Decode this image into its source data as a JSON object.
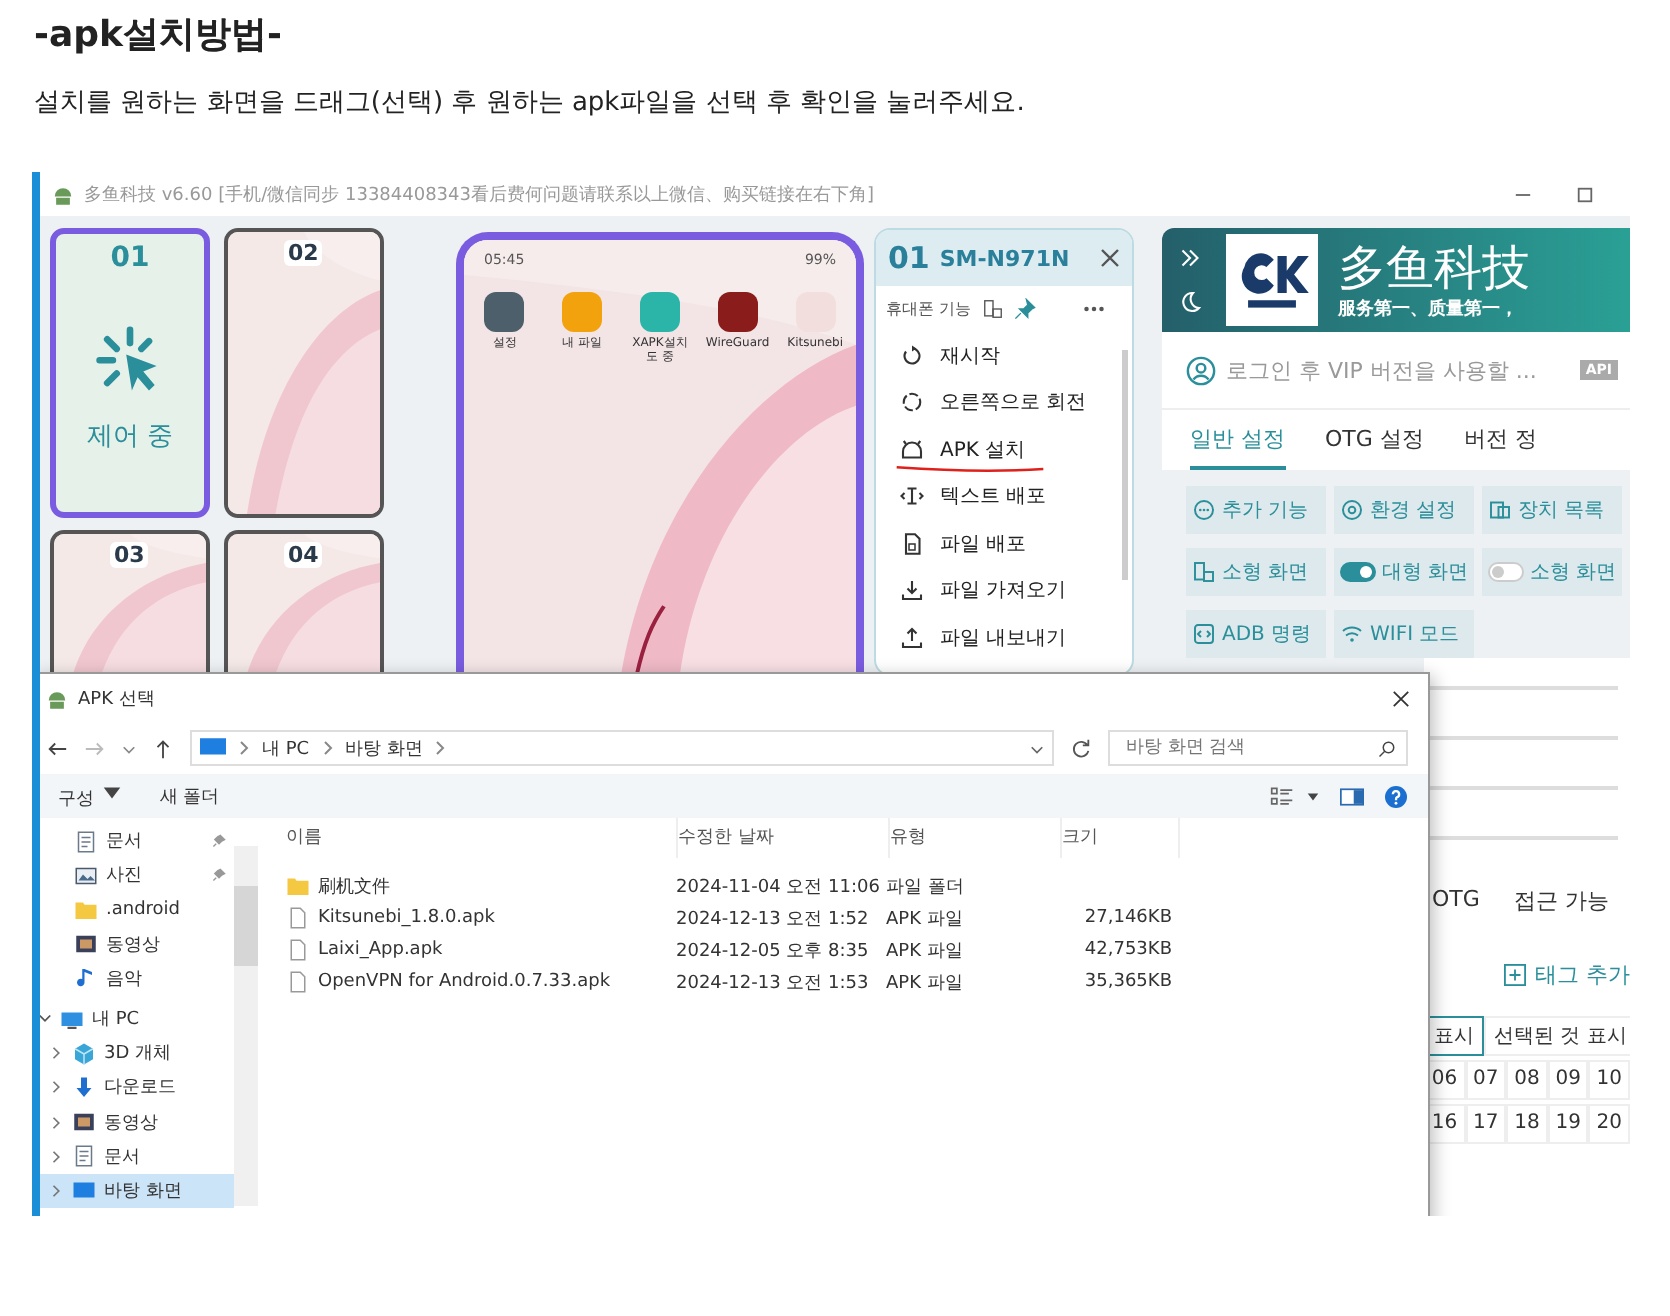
{
  "heading": "-apk설치방법-",
  "instruction": "설치를 원하는 화면을 드래그(선택) 후 원하는 apk파일을 선택 후 확인을 눌러주세요.",
  "app": {
    "title": "多鱼科技 v6.60 [手机/微信同步 13384408343看后费何问题请联系以上微信、购买链接在右下角]",
    "devices": [
      {
        "number": "01",
        "status": "제어 중",
        "selected": true
      },
      {
        "number": "02",
        "selected": false
      },
      {
        "number": "03",
        "selected": false
      },
      {
        "number": "04",
        "selected": false
      }
    ],
    "phone": {
      "time": "05:45",
      "battery": "99%",
      "apps": [
        {
          "label": "설정",
          "color": "#4d5f6b"
        },
        {
          "label": "내 파일",
          "color": "#f2a20c"
        },
        {
          "label": "XAPK설치도 중",
          "color": "#2bb5a8"
        },
        {
          "label": "WireGuard",
          "color": "#8a1c1c"
        },
        {
          "label": "Kitsunebi",
          "color": "#f3dede"
        }
      ]
    },
    "device_panel": {
      "number": "01",
      "model": "SM-N971N",
      "section": "휴대폰 기능",
      "items": [
        {
          "kind": "restart",
          "label": "재시작",
          "marked": false
        },
        {
          "kind": "rotate",
          "label": "오른쪽으로 회전",
          "marked": false
        },
        {
          "kind": "android",
          "label": "APK 설치",
          "marked": true
        },
        {
          "kind": "text",
          "label": "텍스트 배포",
          "marked": false
        },
        {
          "kind": "file",
          "label": "파일 배포",
          "marked": false
        },
        {
          "kind": "import",
          "label": "파일 가져오기",
          "marked": false
        },
        {
          "kind": "export",
          "label": "파일 내보내기",
          "marked": false
        }
      ]
    },
    "side_panel": {
      "brand": "多鱼科技",
      "slogan": "服务第一、质量第一，",
      "login": "로그인 후 VIP 버전을 사용할 ...",
      "api": "API",
      "tabs": [
        {
          "label": "일반 설정",
          "selected": true
        },
        {
          "label": "OTG 설정",
          "selected": false
        },
        {
          "label": "버전 정",
          "selected": false
        }
      ],
      "buttons": [
        {
          "kind": "more",
          "label": "추가 기능"
        },
        {
          "kind": "settings",
          "label": "환경 설정"
        },
        {
          "kind": "devices",
          "label": "장치 목록"
        },
        {
          "kind": "screen",
          "label": "소형 화면"
        },
        {
          "kind": "toggle",
          "label": "대형 화면",
          "on": true
        },
        {
          "kind": "toggle",
          "label": "소형 화면",
          "on": false
        },
        {
          "kind": "adb",
          "label": "ADB 명령"
        },
        {
          "kind": "wifi",
          "label": "WIFI 모드"
        }
      ],
      "filters": [
        "OTG",
        "접근 가능"
      ],
      "add_tag": "태그 추가",
      "show_buttons": [
        {
          "label": "표시",
          "selected": true
        },
        {
          "label": "선택된 것 표시",
          "selected": false
        }
      ],
      "numbers": [
        [
          "06",
          "07",
          "08",
          "09",
          "10"
        ],
        [
          "16",
          "17",
          "18",
          "19",
          "20"
        ]
      ]
    }
  },
  "dialog": {
    "title": "APK 선택",
    "path": [
      "내 PC",
      "바탕 화면"
    ],
    "search": {
      "placeholder": "바탕 화면 검색"
    },
    "toolbar": [
      "구성",
      "새 폴더"
    ],
    "nav": [
      {
        "kind": "docs",
        "label": "문서",
        "pinned": true,
        "selected": false
      },
      {
        "kind": "pictures",
        "label": "사진",
        "pinned": true,
        "selected": false
      },
      {
        "kind": "folder",
        "label": ".android",
        "pinned": false,
        "selected": false
      },
      {
        "kind": "video",
        "label": "동영상",
        "pinned": false,
        "selected": false
      },
      {
        "kind": "music",
        "label": "음악",
        "pinned": false,
        "selected": false
      },
      {
        "kind": "pc",
        "label": "내 PC",
        "expanded": true,
        "selected": false,
        "children": [
          {
            "kind": "cube",
            "label": "3D 개체",
            "expanded": false,
            "selected": false
          },
          {
            "kind": "download",
            "label": "다운로드",
            "expanded": false,
            "selected": false
          },
          {
            "kind": "video",
            "label": "동영상",
            "expanded": false,
            "selected": false
          },
          {
            "kind": "docs",
            "label": "문서",
            "expanded": false,
            "selected": false
          },
          {
            "kind": "desktop",
            "label": "바탕 화면",
            "expanded": false,
            "selected": true
          }
        ]
      }
    ],
    "columns": [
      "이름",
      "수정한 날짜",
      "유형",
      "크기"
    ],
    "files": [
      {
        "kind": "folder",
        "name": "刷机文件",
        "date": "2024-11-04 오전 11:06",
        "type": "파일 폴더"
      },
      {
        "kind": "file",
        "name": "Kitsunebi_1.8.0.apk",
        "date": "2024-12-13 오전 1:52",
        "type": "APK 파일",
        "size": "27,146KB"
      },
      {
        "kind": "file",
        "name": "Laixi_App.apk",
        "date": "2024-12-05 오후 8:35",
        "type": "APK 파일",
        "size": "42,753KB"
      },
      {
        "kind": "file",
        "name": "OpenVPN for Android.0.7.33.apk",
        "date": "2024-12-13 오전 1:53",
        "type": "APK 파일",
        "size": "35,365KB"
      }
    ]
  }
}
